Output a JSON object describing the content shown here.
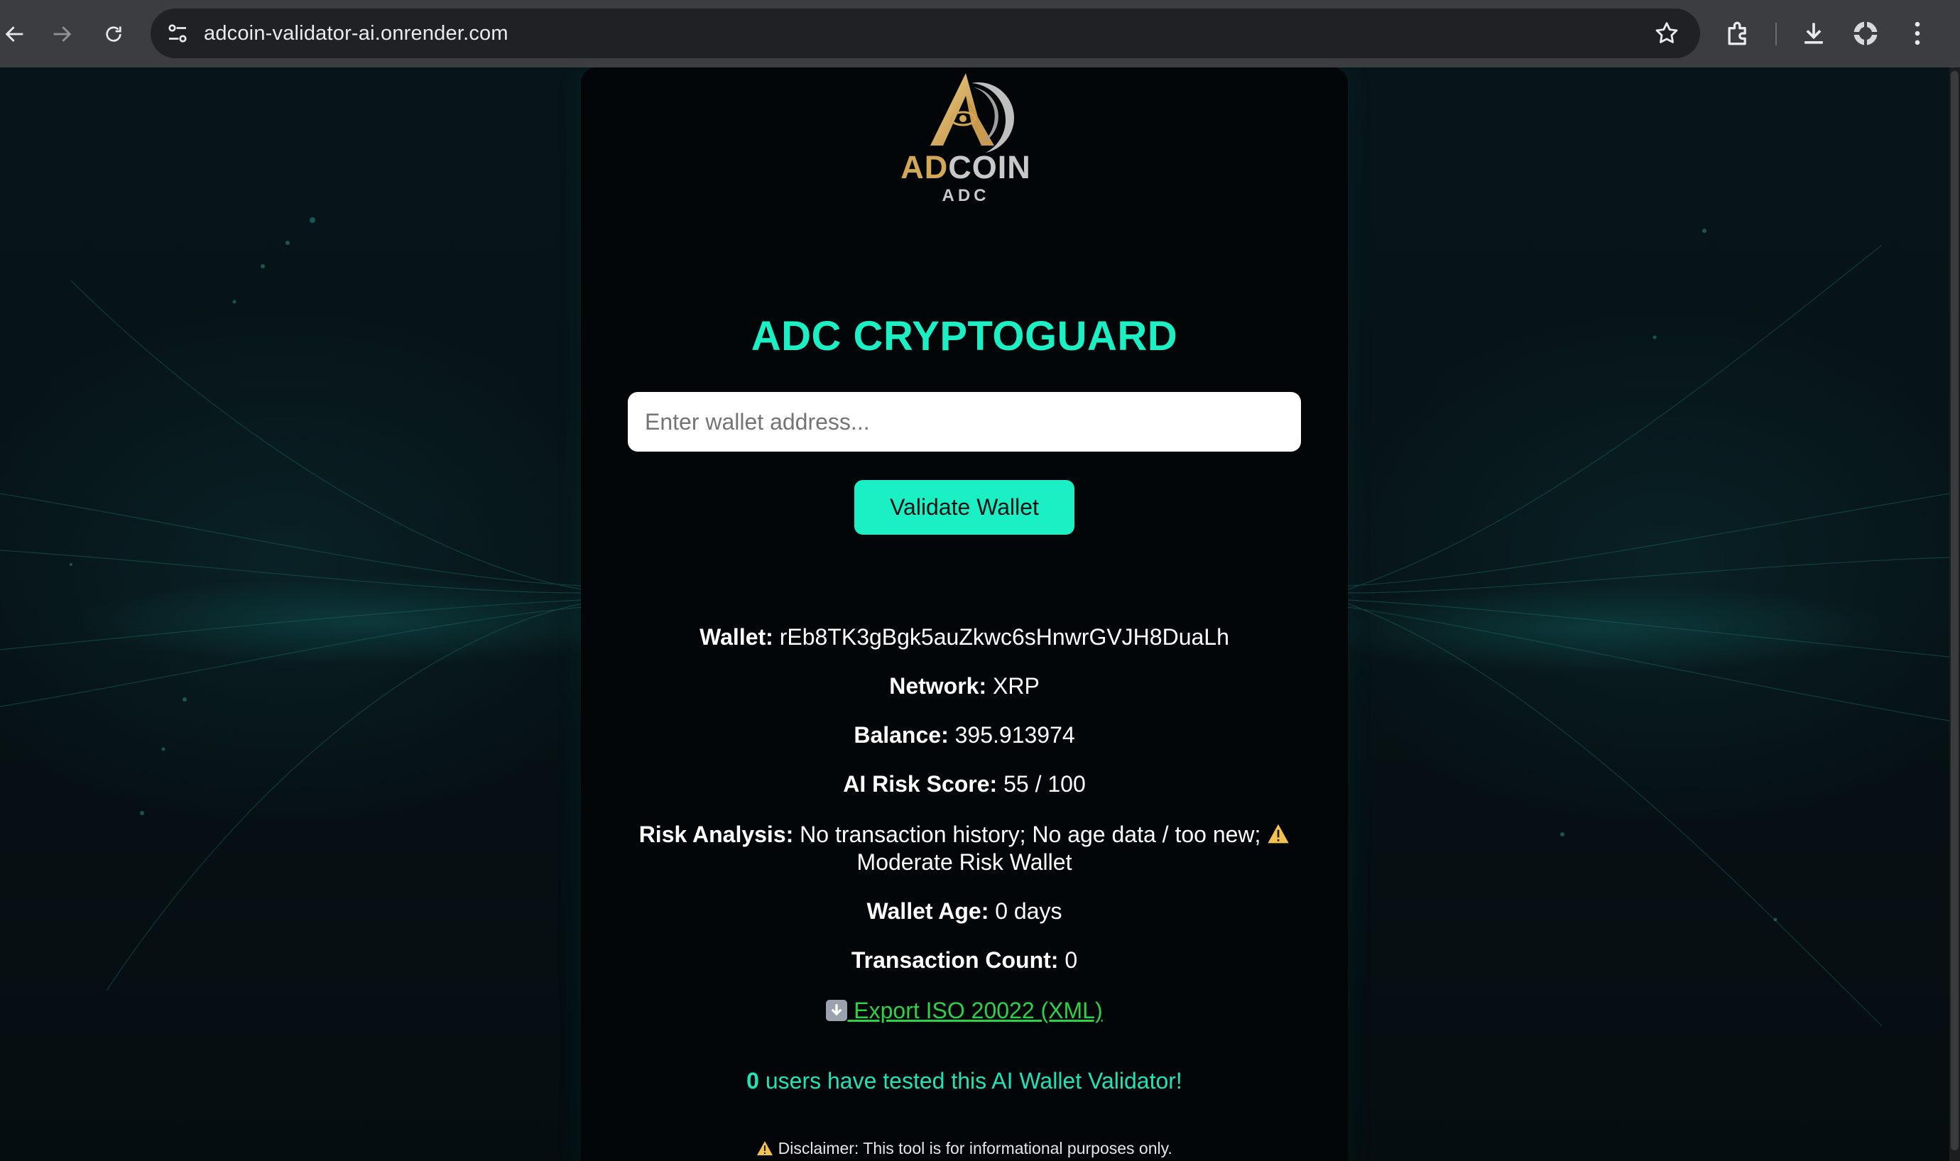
{
  "browser": {
    "url": "adcoin-validator-ai.onrender.com"
  },
  "brand": {
    "name_part1": "AD",
    "name_part2": "COIN",
    "ticker": "ADC"
  },
  "main": {
    "title": "ADC CRYPTOGUARD",
    "wallet_input_placeholder": "Enter wallet address...",
    "wallet_input_value": "",
    "validate_button_label": "Validate Wallet"
  },
  "results": {
    "wallet_label": "Wallet:",
    "wallet_value": "rEb8TK3gBgk5auZkwc6sHnwrGVJH8DuaLh",
    "network_label": "Network:",
    "network_value": "XRP",
    "balance_label": "Balance:",
    "balance_value": "395.913974",
    "risk_score_label": "AI Risk Score:",
    "risk_score_value": "55 / 100",
    "risk_analysis_label": "Risk Analysis:",
    "risk_analysis_value": "No transaction history; No age data / too new;",
    "risk_analysis_verdict": "Moderate Risk Wallet",
    "wallet_age_label": "Wallet Age:",
    "wallet_age_value": "0 days",
    "tx_count_label": "Transaction Count:",
    "tx_count_value": "0",
    "export_link_label": "Export ISO 20022 (XML)"
  },
  "footer": {
    "users_count": "0",
    "users_text": "users have tested this AI Wallet Validator!",
    "disclaimer": "Disclaimer: This tool is for informational purposes only."
  },
  "colors": {
    "accent": "#1af0c3",
    "link_green": "#2bd146",
    "gold": "#d3a755",
    "warning": "#f2c14e"
  },
  "icons": [
    "back-arrow-icon",
    "forward-arrow-icon",
    "reload-icon",
    "site-settings-icon",
    "bookmark-star-icon",
    "extensions-icon",
    "download-icon",
    "profile-icon",
    "menu-kebab-icon",
    "warning-icon",
    "download-box-icon"
  ]
}
